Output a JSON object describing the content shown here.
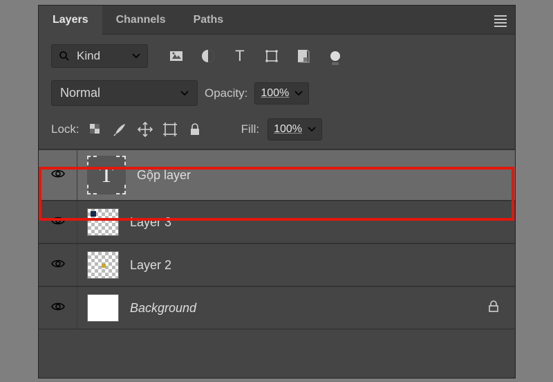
{
  "tabs": {
    "layers": "Layers",
    "channels": "Channels",
    "paths": "Paths"
  },
  "filter": {
    "kind": "Kind"
  },
  "blend": {
    "mode": "Normal",
    "opacity_label": "Opacity:",
    "opacity_value": "100%"
  },
  "lock": {
    "label": "Lock:",
    "fill_label": "Fill:",
    "fill_value": "100%"
  },
  "layers": [
    {
      "name": "Gộp layer"
    },
    {
      "name": "Layer 3"
    },
    {
      "name": "Layer 2"
    },
    {
      "name": "Background"
    }
  ]
}
